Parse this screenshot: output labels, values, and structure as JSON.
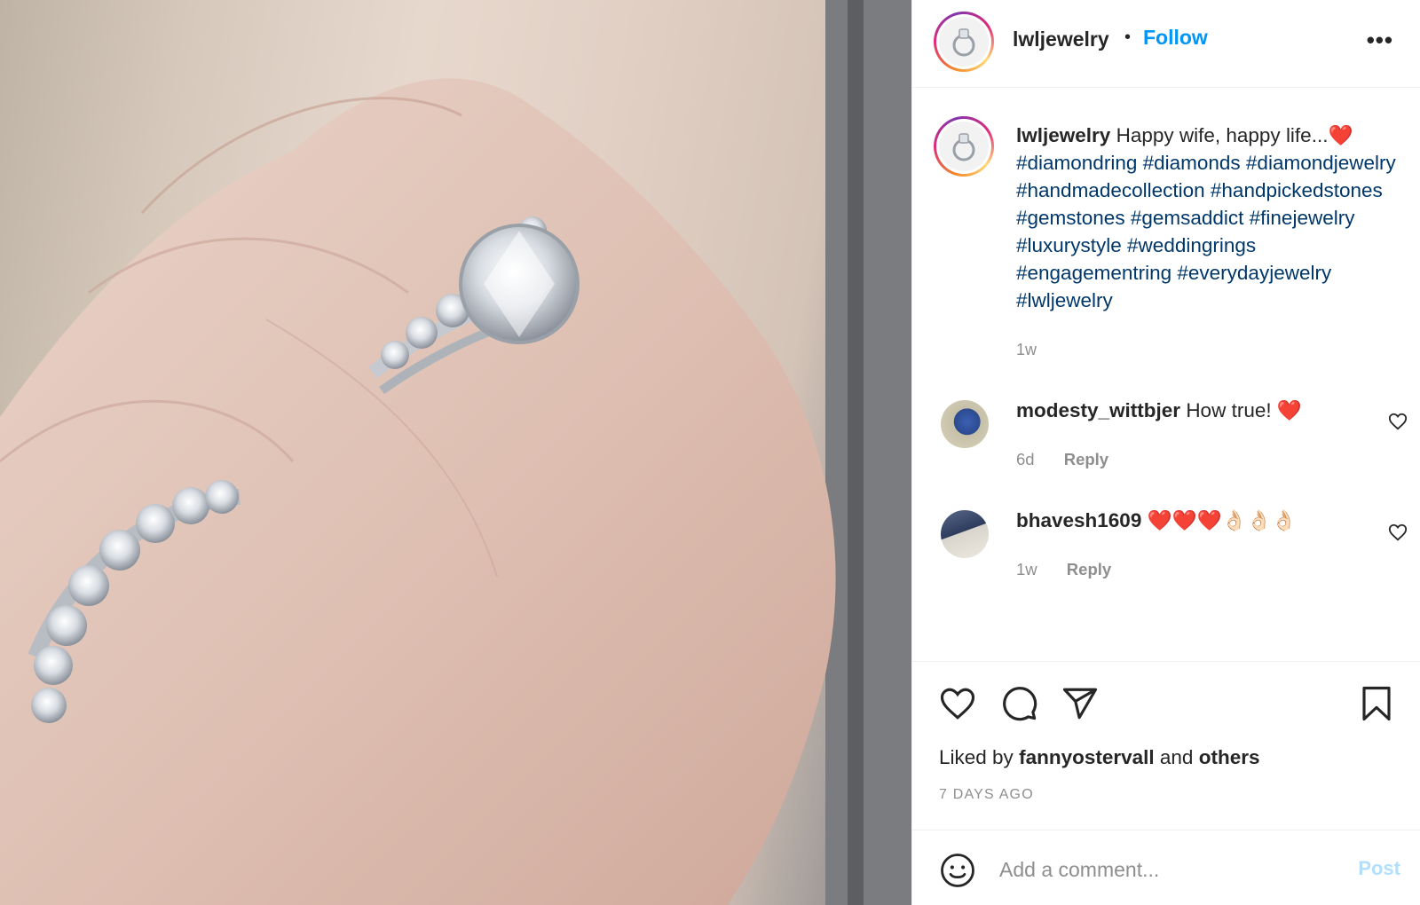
{
  "post": {
    "username": "lwljewelry",
    "follow_label": "Follow",
    "separator": "•",
    "more_label": "•••",
    "caption_text": "Happy wife, happy life...❤️",
    "hashtags": "#diamondring #diamonds #diamondjewelry #handmadecollection #handpickedstones #gemstones #gemsaddict #finejewelry #luxurystyle #weddingrings #engagementring #everydayjewelry #lwljewelry",
    "caption_time": "1w"
  },
  "comments": [
    {
      "username": "modesty_wittbjer",
      "text": "How true! ❤️",
      "time": "6d",
      "reply_label": "Reply"
    },
    {
      "username": "bhavesh1609",
      "text": "❤️❤️❤️👌🏻👌🏻👌🏻",
      "time": "1w",
      "reply_label": "Reply"
    }
  ],
  "likes": {
    "prefix": "Liked by",
    "user": "fannyostervall",
    "joiner": "and",
    "others": "others",
    "date": "7 DAYS AGO"
  },
  "add_comment": {
    "placeholder": "Add a comment...",
    "post_label": "Post"
  },
  "icons": {
    "header_more": "more-icon",
    "like": "heart-icon",
    "comment": "comment-icon",
    "share": "share-icon",
    "save": "bookmark-icon",
    "emoji": "emoji-icon"
  },
  "colors": {
    "link": "#0095f6",
    "hashtag": "#00376b",
    "muted": "#8e8e8e",
    "post_disabled": "#b2dffc"
  }
}
